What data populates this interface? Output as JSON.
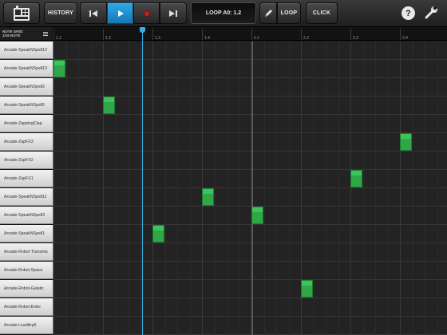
{
  "toolbar": {
    "history_label": "HISTORY",
    "loop_display": "LOOP A0: 1.2",
    "loop_label": "LOOP",
    "click_label": "CLICK",
    "accent": "#2196d6",
    "record_color": "#c81e1e"
  },
  "grid_header": {
    "line1": "NOTE GRID:",
    "line2": "1/16 NOTE"
  },
  "ruler": [
    "1.1",
    "1.2",
    "1.3",
    "1.4",
    "2.1",
    "2.2",
    "2.3",
    "2.4"
  ],
  "samples": [
    "Arcade-SpeakNSpell12",
    "Arcade-SpeakNSpell13",
    "Arcade-SpeakNSpell2",
    "Arcade-SpeakNSpell5",
    "Arcade-ZappingClap",
    "Arcade-ZapFX3",
    "Arcade-ZapFX2",
    "Arcade-ZapFX1",
    "Arcade-SpeakNSpell11",
    "Arcade-SpeakNSpell3",
    "Arcade-SpeakNSpell1",
    "Arcade-Robot-Transmis",
    "Arcade-Robot-Space",
    "Arcade-Robot-Galatic",
    "Arcade-Robot-Enter",
    "Arcade-LeadArp6"
  ],
  "notes": [
    {
      "row": 1,
      "step": 0
    },
    {
      "row": 3,
      "step": 4
    },
    {
      "row": 10,
      "step": 8
    },
    {
      "row": 8,
      "step": 12
    },
    {
      "row": 9,
      "step": 16
    },
    {
      "row": 13,
      "step": 20
    },
    {
      "row": 7,
      "step": 24
    },
    {
      "row": 5,
      "step": 28
    }
  ],
  "note_color": "#3fc45a",
  "icons": {
    "app": "drum-machine-icon",
    "rewind": "skip-back-icon",
    "play": "play-icon",
    "record": "record-icon",
    "forward": "skip-forward-icon",
    "edit": "pencil-icon",
    "help": "help-icon",
    "settings": "wrench-icon"
  }
}
